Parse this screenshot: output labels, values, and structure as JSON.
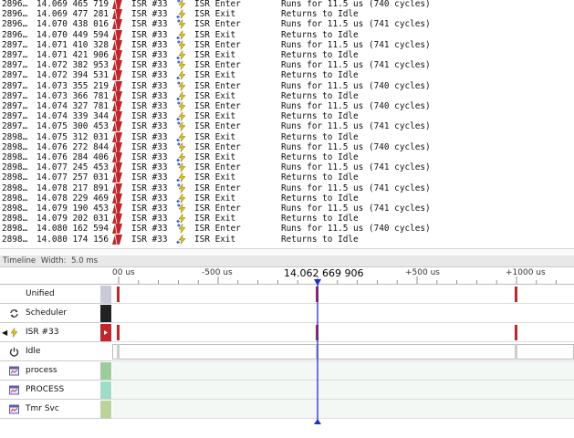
{
  "log_rows": [
    {
      "idx": "2896…",
      "time": "14.069 465 719",
      "src": "ISR #33",
      "event": "ISR Enter",
      "kind": "enter",
      "desc": "Runs for 11.5 us (740 cycles)"
    },
    {
      "idx": "2896…",
      "time": "14.069 477 281",
      "src": "ISR #33",
      "event": "ISR Exit",
      "kind": "exit",
      "desc": "Returns to Idle"
    },
    {
      "idx": "2896…",
      "time": "14.070 438 016",
      "src": "ISR #33",
      "event": "ISR Enter",
      "kind": "enter",
      "desc": "Runs for 11.5 us (741 cycles)"
    },
    {
      "idx": "2896…",
      "time": "14.070 449 594",
      "src": "ISR #33",
      "event": "ISR Exit",
      "kind": "exit",
      "desc": "Returns to Idle"
    },
    {
      "idx": "2897…",
      "time": "14.071 410 328",
      "src": "ISR #33",
      "event": "ISR Enter",
      "kind": "enter",
      "desc": "Runs for 11.5 us (741 cycles)"
    },
    {
      "idx": "2897…",
      "time": "14.071 421 906",
      "src": "ISR #33",
      "event": "ISR Exit",
      "kind": "exit",
      "desc": "Returns to Idle"
    },
    {
      "idx": "2897…",
      "time": "14.072 382 953",
      "src": "ISR #33",
      "event": "ISR Enter",
      "kind": "enter",
      "desc": "Runs for 11.5 us (741 cycles)"
    },
    {
      "idx": "2897…",
      "time": "14.072 394 531",
      "src": "ISR #33",
      "event": "ISR Exit",
      "kind": "exit",
      "desc": "Returns to Idle"
    },
    {
      "idx": "2897…",
      "time": "14.073 355 219",
      "src": "ISR #33",
      "event": "ISR Enter",
      "kind": "enter",
      "desc": "Runs for 11.5 us (740 cycles)"
    },
    {
      "idx": "2897…",
      "time": "14.073 366 781",
      "src": "ISR #33",
      "event": "ISR Exit",
      "kind": "exit",
      "desc": "Returns to Idle"
    },
    {
      "idx": "2897…",
      "time": "14.074 327 781",
      "src": "ISR #33",
      "event": "ISR Enter",
      "kind": "enter",
      "desc": "Runs for 11.5 us (740 cycles)"
    },
    {
      "idx": "2897…",
      "time": "14.074 339 344",
      "src": "ISR #33",
      "event": "ISR Exit",
      "kind": "exit",
      "desc": "Returns to Idle"
    },
    {
      "idx": "2897…",
      "time": "14.075 300 453",
      "src": "ISR #33",
      "event": "ISR Enter",
      "kind": "enter",
      "desc": "Runs for 11.5 us (741 cycles)"
    },
    {
      "idx": "2898…",
      "time": "14.075 312 031",
      "src": "ISR #33",
      "event": "ISR Exit",
      "kind": "exit",
      "desc": "Returns to Idle"
    },
    {
      "idx": "2898…",
      "time": "14.076 272 844",
      "src": "ISR #33",
      "event": "ISR Enter",
      "kind": "enter",
      "desc": "Runs for 11.5 us (740 cycles)"
    },
    {
      "idx": "2898…",
      "time": "14.076 284 406",
      "src": "ISR #33",
      "event": "ISR Exit",
      "kind": "exit",
      "desc": "Returns to Idle"
    },
    {
      "idx": "2898…",
      "time": "14.077 245 453",
      "src": "ISR #33",
      "event": "ISR Enter",
      "kind": "enter",
      "desc": "Runs for 11.5 us (741 cycles)"
    },
    {
      "idx": "2898…",
      "time": "14.077 257 031",
      "src": "ISR #33",
      "event": "ISR Exit",
      "kind": "exit",
      "desc": "Returns to Idle"
    },
    {
      "idx": "2898…",
      "time": "14.078 217 891",
      "src": "ISR #33",
      "event": "ISR Enter",
      "kind": "enter",
      "desc": "Runs for 11.5 us (741 cycles)"
    },
    {
      "idx": "2898…",
      "time": "14.078 229 469",
      "src": "ISR #33",
      "event": "ISR Exit",
      "kind": "exit",
      "desc": "Returns to Idle"
    },
    {
      "idx": "2898…",
      "time": "14.079 190 453",
      "src": "ISR #33",
      "event": "ISR Enter",
      "kind": "enter",
      "desc": "Runs for 11.5 us (741 cycles)"
    },
    {
      "idx": "2898…",
      "time": "14.079 202 031",
      "src": "ISR #33",
      "event": "ISR Exit",
      "kind": "exit",
      "desc": "Returns to Idle"
    },
    {
      "idx": "2898…",
      "time": "14.080 162 594",
      "src": "ISR #33",
      "event": "ISR Enter",
      "kind": "enter",
      "desc": "Runs for 11.5 us (740 cycles)"
    },
    {
      "idx": "2898…",
      "time": "14.080 174 156",
      "src": "ISR #33",
      "event": "ISR Exit",
      "kind": "exit",
      "desc": "Returns to Idle"
    }
  ],
  "timeline": {
    "header_title": "Timeline",
    "width_label": "Width:",
    "width_value": "5.0 ms",
    "cursor_time": "14.062 669 906",
    "ticks": [
      {
        "label": "00 us"
      },
      {
        "label": "-500 us"
      },
      {
        "label": "+500 us"
      },
      {
        "label": "+1000 us"
      }
    ],
    "lanes": [
      {
        "name": "Unified",
        "icon": "none-icon",
        "swatch": "#c9cbd8"
      },
      {
        "name": "Scheduler",
        "icon": "scheduler-cycle-icon",
        "swatch": "#222222"
      },
      {
        "name": "ISR #33",
        "icon": "isr-bolt-icon",
        "swatch": "#c0262b",
        "expander": "◀"
      },
      {
        "name": "Idle",
        "icon": "idle-power-icon",
        "swatch": ""
      },
      {
        "name": "process",
        "icon": "task-window-icon",
        "swatch": "#9ccc9c"
      },
      {
        "name": "PROCESS",
        "icon": "task-window-icon",
        "swatch": "#9fdcc8"
      },
      {
        "name": "Tmr Svc",
        "icon": "task-window-icon",
        "swatch": "#b9d39a"
      }
    ]
  },
  "colors": {
    "isr": "#c0262b",
    "cursor": "#1f2fd0"
  }
}
